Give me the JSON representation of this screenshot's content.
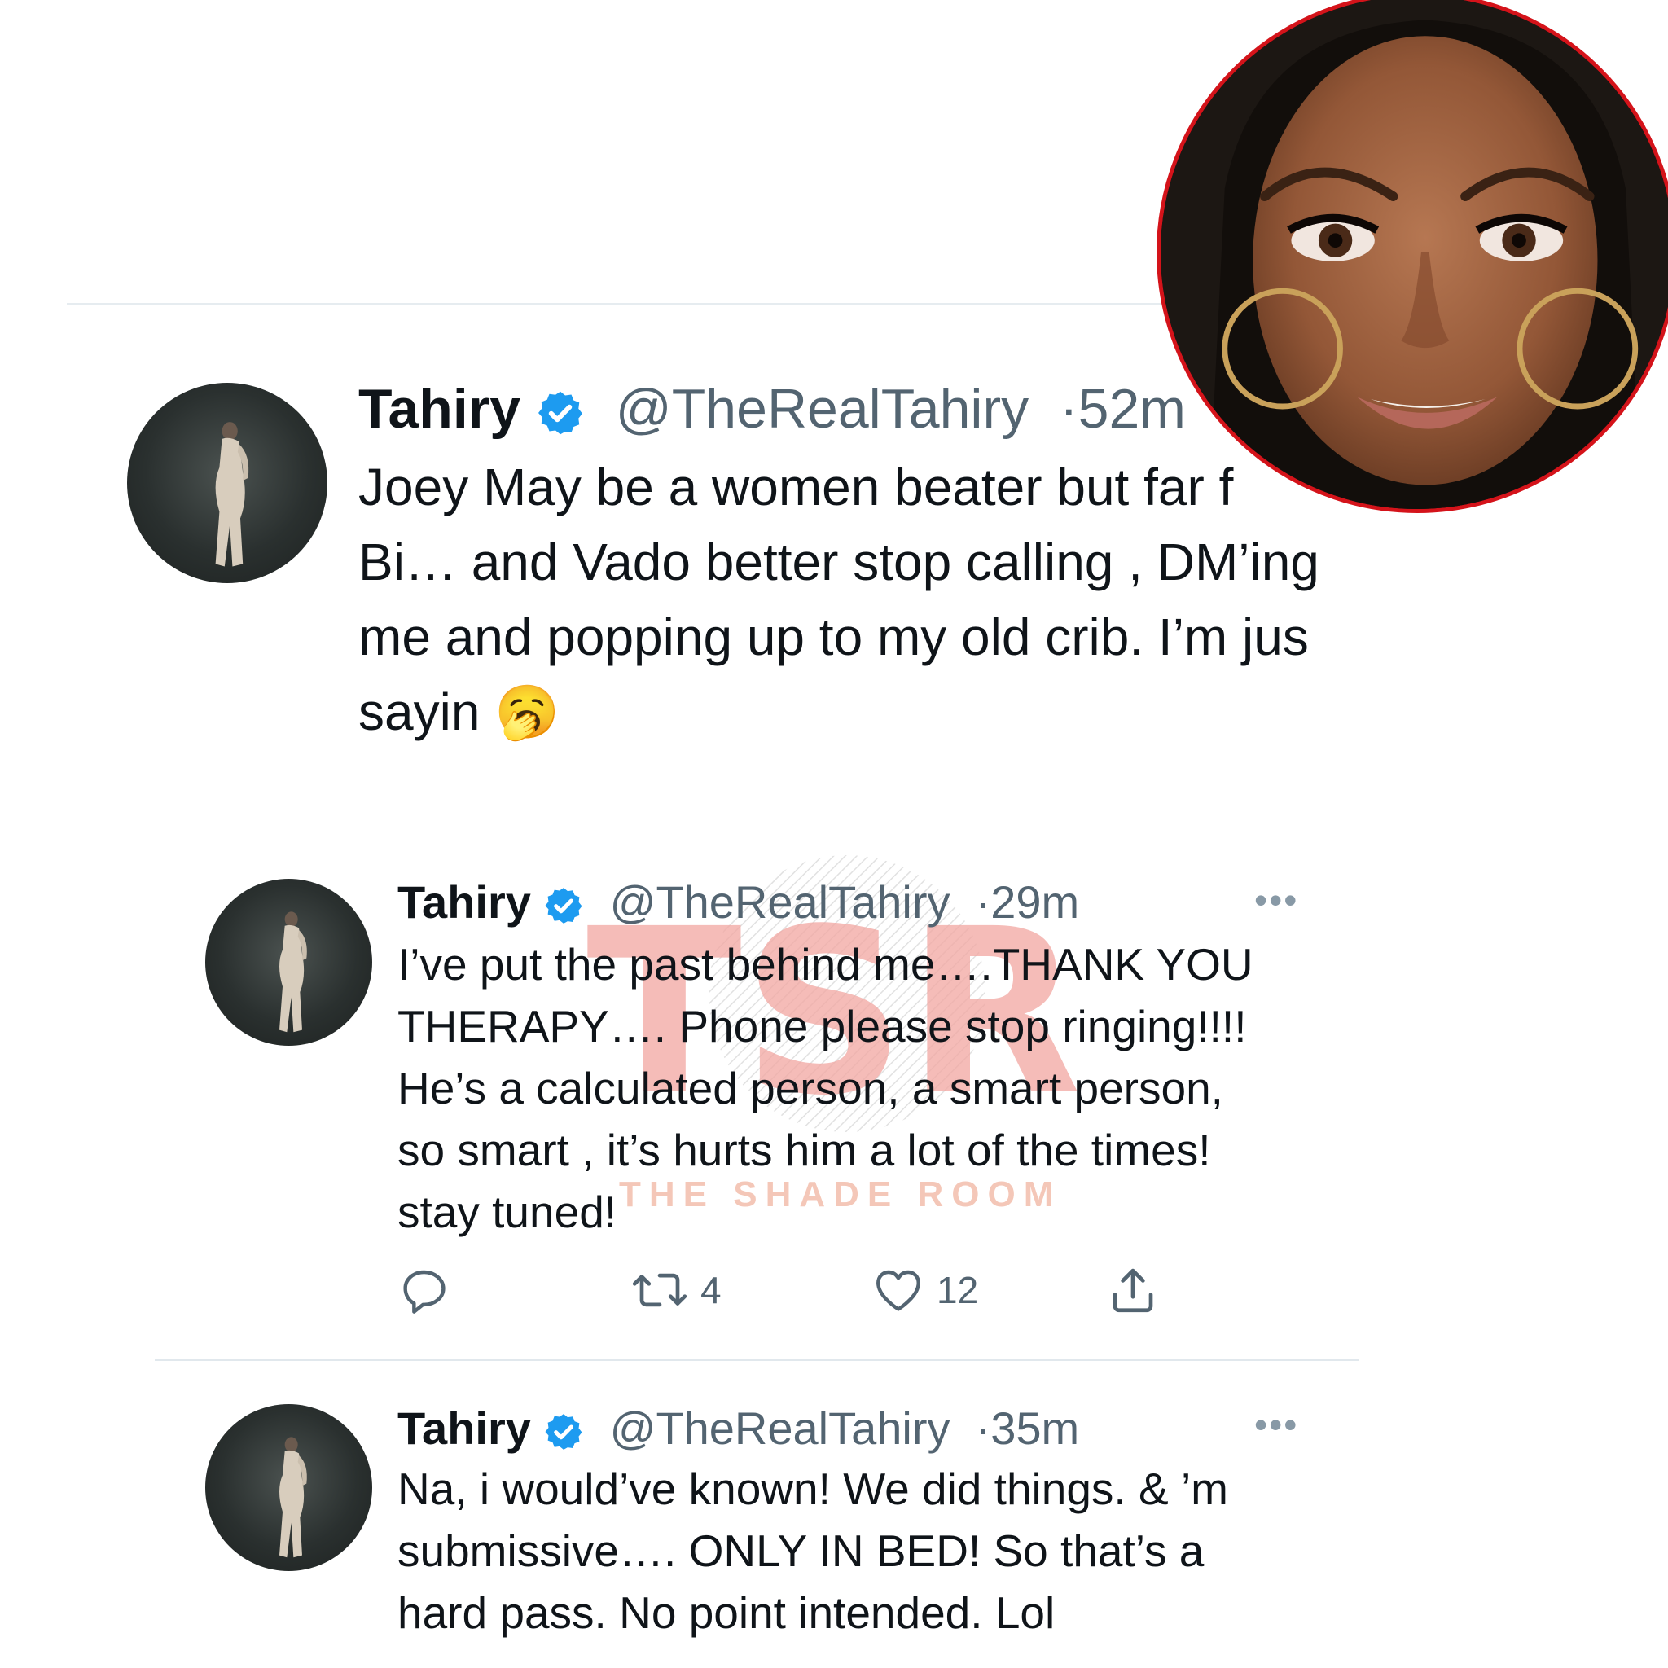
{
  "tweets": [
    {
      "name": "Tahiry",
      "handle": "@TheRealTahiry",
      "separator": "·",
      "time": "52m",
      "text": "Joey May be a women beater but far f\nBi… and Vado better stop calling , DM’ing\nme and popping up to my old crib. I’m jus\nsayin 🥱"
    },
    {
      "name": "Tahiry",
      "handle": "@TheRealTahiry",
      "separator": "·",
      "time": "29m",
      "more": "•••",
      "text": "I’ve put the past behind me….THANK YOU\nTHERAPY…. Phone please stop ringing!!!!\nHe’s a calculated person, a smart person,\nso smart , it’s hurts him a lot of the times!\nstay tuned!",
      "actions": {
        "retweets": "4",
        "likes": "12"
      }
    },
    {
      "name": "Tahiry",
      "handle": "@TheRealTahiry",
      "separator": "·",
      "time": "35m",
      "more": "•••",
      "text": "Na, i would’ve known! We did things. & ’m\nsubmissive…. ONLY IN BED! So that’s a\nhard pass. No point intended. Lol"
    }
  ],
  "watermark": {
    "letters": "TSR",
    "label": "THE SHADE ROOM"
  },
  "icons": {
    "verified": "verified-badge-icon",
    "reply": "reply-icon",
    "retweet": "retweet-icon",
    "like": "heart-icon",
    "share": "share-icon",
    "more": "more-icon"
  },
  "colors": {
    "verified_blue": "#1d9bf0",
    "text": "#0f1419",
    "secondary": "#536471",
    "inset_border": "#d4131a",
    "watermark": "#f2a5a0"
  }
}
